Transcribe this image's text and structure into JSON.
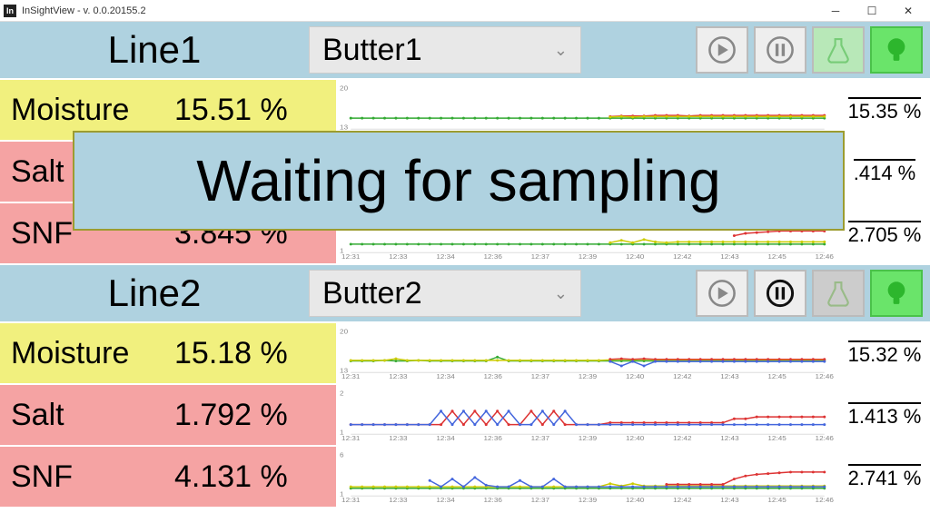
{
  "window": {
    "title": "InSightView - v. 0.0.20155.2",
    "icon_text": "In"
  },
  "overlay": {
    "text": "Waiting for sampling"
  },
  "lines": [
    {
      "name": "Line1",
      "product": "Butter1",
      "play_active": false,
      "pause_active": false,
      "measures": [
        {
          "name": "Moisture",
          "value": "15.51 %",
          "bg": "yellow",
          "avg": "15.35 %",
          "ymin": "13",
          "ymax": "20",
          "chart": "m1"
        },
        {
          "name": "Salt",
          "value": "",
          "bg": "red",
          "avg": ".414 %",
          "ymin": "1",
          "ymax": "2",
          "chart": "s1"
        },
        {
          "name": "SNF",
          "value": "3.845 %",
          "bg": "red",
          "avg": "2.705 %",
          "ymin": "1",
          "ymax": "6",
          "chart": "n1"
        }
      ],
      "ticks": [
        "12:31",
        "12:33",
        "12:34",
        "12:36",
        "12:37",
        "12:39",
        "12:40",
        "12:42",
        "12:43",
        "12:45",
        "12:46"
      ]
    },
    {
      "name": "Line2",
      "product": "Butter2",
      "play_active": false,
      "pause_active": true,
      "measures": [
        {
          "name": "Moisture",
          "value": "15.18 %",
          "bg": "yellow",
          "avg": "15.32 %",
          "ymin": "13",
          "ymax": "20",
          "chart": "m2"
        },
        {
          "name": "Salt",
          "value": "1.792 %",
          "bg": "red",
          "avg": "1.413 %",
          "ymin": "1",
          "ymax": "2",
          "chart": "s2"
        },
        {
          "name": "SNF",
          "value": "4.131 %",
          "bg": "red",
          "avg": "2.741 %",
          "ymin": "1",
          "ymax": "6",
          "chart": "n2"
        }
      ],
      "ticks": [
        "12:31",
        "12:33",
        "12:34",
        "12:36",
        "12:37",
        "12:39",
        "12:40",
        "12:42",
        "12:43",
        "12:45",
        "12:46"
      ]
    }
  ],
  "chart_data": [
    {
      "id": "m1",
      "type": "line",
      "ylim": [
        13,
        20
      ],
      "series": [
        {
          "name": "g",
          "color": "#3a3",
          "values": [
            15,
            15,
            15,
            15,
            15,
            15,
            15,
            15,
            15,
            15,
            15,
            15,
            15,
            15,
            15,
            15,
            15,
            15,
            15,
            15,
            15,
            15,
            15,
            15,
            15,
            15,
            15,
            15,
            15,
            15,
            15,
            15,
            15,
            15,
            15,
            15,
            15,
            15,
            15,
            15,
            15,
            15,
            15
          ]
        },
        {
          "name": "r",
          "color": "#d33",
          "values": [
            null,
            null,
            null,
            null,
            null,
            null,
            null,
            null,
            null,
            null,
            null,
            null,
            null,
            null,
            null,
            null,
            null,
            null,
            null,
            null,
            null,
            null,
            null,
            15.3,
            15.4,
            15.4,
            15.4,
            15.5,
            15.5,
            15.5,
            15.4,
            15.5,
            15.5,
            15.5,
            15.5,
            15.5,
            15.5,
            15.5,
            15.5,
            15.5,
            15.5,
            15.5,
            15.5
          ]
        },
        {
          "name": "y",
          "color": "#cc0",
          "values": [
            null,
            null,
            null,
            null,
            null,
            null,
            null,
            null,
            null,
            null,
            null,
            null,
            null,
            null,
            null,
            null,
            null,
            null,
            null,
            null,
            null,
            null,
            null,
            15.2,
            15.3,
            15.2,
            15.3,
            15.3,
            15.3,
            15.3,
            15.3,
            15.3,
            15.3,
            15.3,
            15.3,
            15.3,
            15.3,
            15.3,
            15.3,
            15.3,
            15.3,
            15.3,
            15.3
          ]
        }
      ]
    },
    {
      "id": "n1",
      "type": "line",
      "ylim": [
        1,
        6
      ],
      "series": [
        {
          "name": "g",
          "color": "#3a3",
          "values": [
            2.1,
            2.1,
            2.1,
            2.1,
            2.1,
            2.1,
            2.1,
            2.1,
            2.1,
            2.1,
            2.1,
            2.1,
            2.1,
            2.1,
            2.1,
            2.1,
            2.1,
            2.1,
            2.1,
            2.1,
            2.1,
            2.1,
            2.1,
            2.1,
            2.1,
            2.1,
            2.1,
            2.1,
            2.1,
            2.1,
            2.1,
            2.1,
            2.1,
            2.1,
            2.1,
            2.1,
            2.1,
            2.1,
            2.1,
            2.1,
            2.1,
            2.1,
            2.1
          ]
        },
        {
          "name": "y",
          "color": "#cc0",
          "values": [
            null,
            null,
            null,
            null,
            null,
            null,
            null,
            null,
            null,
            null,
            null,
            null,
            null,
            null,
            null,
            null,
            null,
            null,
            null,
            null,
            null,
            null,
            null,
            2.3,
            2.6,
            2.3,
            2.7,
            2.4,
            2.3,
            2.4,
            2.4,
            2.4,
            2.4,
            2.4,
            2.4,
            2.4,
            2.4,
            2.4,
            2.4,
            2.4,
            2.4,
            2.4,
            2.4
          ]
        },
        {
          "name": "r",
          "color": "#d33",
          "values": [
            null,
            null,
            null,
            null,
            null,
            null,
            null,
            null,
            null,
            null,
            null,
            null,
            null,
            null,
            null,
            null,
            null,
            null,
            null,
            null,
            null,
            null,
            null,
            null,
            null,
            null,
            null,
            null,
            null,
            null,
            null,
            null,
            null,
            null,
            3.2,
            3.5,
            3.6,
            3.7,
            3.8,
            3.8,
            3.8,
            3.8,
            3.8
          ]
        }
      ]
    },
    {
      "id": "m2",
      "type": "line",
      "ylim": [
        13,
        20
      ],
      "series": [
        {
          "name": "g",
          "color": "#3a3",
          "values": [
            15.1,
            15.1,
            15.1,
            15.2,
            15.1,
            15.1,
            15.2,
            15.1,
            15.1,
            15.1,
            15.1,
            15.1,
            15.1,
            15.8,
            15.1,
            15.1,
            15.1,
            15.1,
            15.1,
            15.1,
            15.1,
            15.1,
            15.1,
            15.1,
            15.1,
            15.1,
            15.1,
            15.1,
            15.1,
            15.1,
            15.1,
            15.1,
            15.1,
            15.1,
            15.1,
            15.1,
            15.1,
            15.1,
            15.1,
            15.1,
            15.1,
            15.1,
            15.1
          ]
        },
        {
          "name": "y",
          "color": "#cc0",
          "values": [
            15.2,
            15.2,
            15.2,
            15.2,
            15.5,
            15.2,
            15.2,
            15.2,
            15.2,
            15.2,
            15.2,
            15.2,
            15.2,
            15.2,
            15.2,
            15.2,
            15.2,
            15.2,
            15.2,
            15.2,
            15.2,
            15.2,
            15.2,
            15.3,
            15.4,
            15.3,
            15.4,
            15.3,
            15.3,
            15.3,
            15.3,
            15.3,
            15.3,
            15.3,
            15.3,
            15.3,
            15.3,
            15.3,
            15.3,
            15.3,
            15.3,
            15.3,
            15.3
          ]
        },
        {
          "name": "r",
          "color": "#d33",
          "values": [
            null,
            null,
            null,
            null,
            null,
            null,
            null,
            null,
            null,
            null,
            null,
            null,
            null,
            null,
            null,
            null,
            null,
            null,
            null,
            null,
            null,
            null,
            null,
            15.4,
            15.5,
            15.4,
            15.5,
            15.4,
            15.4,
            15.4,
            15.4,
            15.4,
            15.4,
            15.4,
            15.4,
            15.4,
            15.4,
            15.4,
            15.4,
            15.4,
            15.4,
            15.4,
            15.4
          ]
        },
        {
          "name": "b",
          "color": "#46d",
          "values": [
            null,
            null,
            null,
            null,
            null,
            null,
            null,
            null,
            null,
            null,
            null,
            null,
            null,
            null,
            null,
            null,
            null,
            null,
            null,
            null,
            null,
            null,
            null,
            15.0,
            14.2,
            15.0,
            14.2,
            15.0,
            15.0,
            15.0,
            15.0,
            15.0,
            15.0,
            15.0,
            15.0,
            15.0,
            15.0,
            15.0,
            15.0,
            15.0,
            15.0,
            15.0,
            15.0
          ]
        }
      ]
    },
    {
      "id": "s2",
      "type": "line",
      "ylim": [
        1,
        2
      ],
      "series": [
        {
          "name": "r",
          "color": "#d33",
          "values": [
            1.25,
            1.25,
            1.25,
            1.25,
            1.25,
            1.25,
            1.25,
            1.25,
            1.25,
            1.6,
            1.25,
            1.6,
            1.25,
            1.6,
            1.25,
            1.25,
            1.6,
            1.25,
            1.6,
            1.25,
            1.25,
            1.25,
            1.25,
            1.3,
            1.3,
            1.3,
            1.3,
            1.3,
            1.3,
            1.3,
            1.3,
            1.3,
            1.3,
            1.3,
            1.4,
            1.4,
            1.45,
            1.45,
            1.45,
            1.45,
            1.45,
            1.45,
            1.45
          ]
        },
        {
          "name": "b",
          "color": "#46d",
          "values": [
            1.25,
            1.25,
            1.25,
            1.25,
            1.25,
            1.25,
            1.25,
            1.25,
            1.6,
            1.25,
            1.6,
            1.25,
            1.6,
            1.25,
            1.6,
            1.25,
            1.25,
            1.6,
            1.25,
            1.6,
            1.25,
            1.25,
            1.25,
            1.25,
            1.25,
            1.25,
            1.25,
            1.25,
            1.25,
            1.25,
            1.25,
            1.25,
            1.25,
            1.25,
            1.25,
            1.25,
            1.25,
            1.25,
            1.25,
            1.25,
            1.25,
            1.25,
            1.25
          ]
        }
      ]
    },
    {
      "id": "n2",
      "type": "line",
      "ylim": [
        1,
        6
      ],
      "series": [
        {
          "name": "g",
          "color": "#3a3",
          "values": [
            2.0,
            2.0,
            2.0,
            2.0,
            2.0,
            2.0,
            2.0,
            2.0,
            2.0,
            2.0,
            2.0,
            2.0,
            2.0,
            2.0,
            2.0,
            2.0,
            2.0,
            2.0,
            2.0,
            2.0,
            2.0,
            2.0,
            2.0,
            2.0,
            2.0,
            2.0,
            2.0,
            2.0,
            2.0,
            2.0,
            2.0,
            2.0,
            2.0,
            2.0,
            2.0,
            2.0,
            2.0,
            2.0,
            2.0,
            2.0,
            2.0,
            2.0,
            2.0
          ]
        },
        {
          "name": "y",
          "color": "#cc0",
          "values": [
            2.2,
            2.2,
            2.2,
            2.2,
            2.2,
            2.2,
            2.2,
            2.2,
            2.2,
            2.2,
            2.2,
            2.2,
            2.2,
            2.2,
            2.2,
            2.2,
            2.2,
            2.2,
            2.2,
            2.2,
            2.2,
            2.2,
            2.2,
            2.6,
            2.3,
            2.6,
            2.3,
            2.3,
            2.3,
            2.3,
            2.3,
            2.3,
            2.3,
            2.3,
            2.3,
            2.3,
            2.3,
            2.3,
            2.3,
            2.3,
            2.3,
            2.3,
            2.3
          ]
        },
        {
          "name": "b",
          "color": "#46d",
          "values": [
            null,
            null,
            null,
            null,
            null,
            null,
            null,
            3.0,
            2.2,
            3.2,
            2.2,
            3.4,
            2.4,
            2.2,
            2.2,
            3.0,
            2.2,
            2.2,
            3.2,
            2.2,
            2.2,
            2.2,
            2.2,
            2.2,
            2.2,
            2.2,
            2.2,
            2.2,
            2.2,
            2.2,
            2.2,
            2.2,
            2.2,
            2.2,
            2.2,
            2.2,
            2.2,
            2.2,
            2.2,
            2.2,
            2.2,
            2.2,
            2.2
          ]
        },
        {
          "name": "r",
          "color": "#d33",
          "values": [
            null,
            null,
            null,
            null,
            null,
            null,
            null,
            null,
            null,
            null,
            null,
            null,
            null,
            null,
            null,
            null,
            null,
            null,
            null,
            null,
            null,
            null,
            null,
            null,
            null,
            null,
            null,
            null,
            2.5,
            2.5,
            2.5,
            2.5,
            2.5,
            2.5,
            3.2,
            3.6,
            3.8,
            3.9,
            4.0,
            4.1,
            4.1,
            4.1,
            4.1
          ]
        }
      ]
    }
  ]
}
